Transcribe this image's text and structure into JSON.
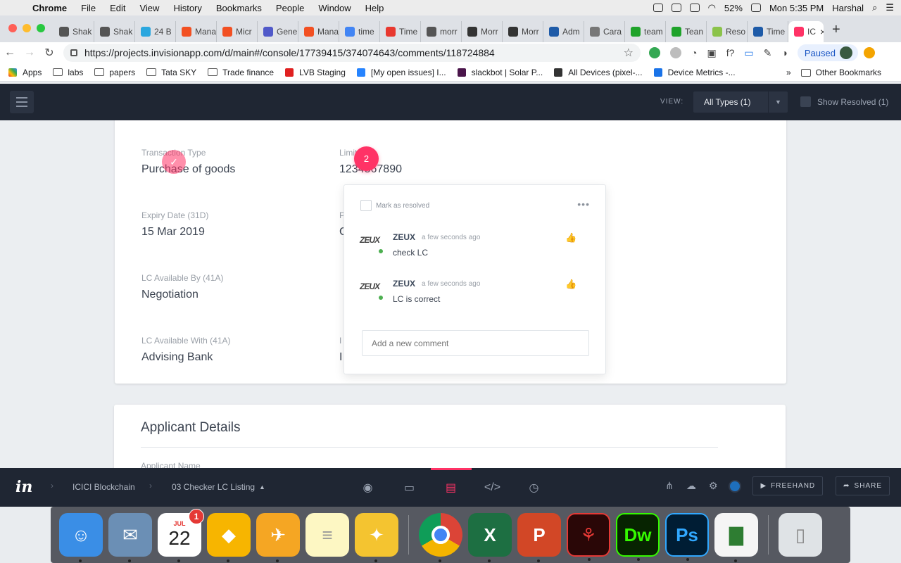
{
  "menubar": {
    "app": "Chrome",
    "items": [
      "File",
      "Edit",
      "View",
      "History",
      "Bookmarks",
      "People",
      "Window",
      "Help"
    ],
    "battery": "52%",
    "clock": "Mon 5:35 PM",
    "user": "Harshal"
  },
  "tabs": [
    {
      "label": "Shak",
      "color": "#555555"
    },
    {
      "label": "Shak",
      "color": "#555555"
    },
    {
      "label": "24 B",
      "color": "#2aa7df"
    },
    {
      "label": "Mana",
      "color": "#f25022"
    },
    {
      "label": "Micr",
      "color": "#f25022"
    },
    {
      "label": "Gene",
      "color": "#5059c9"
    },
    {
      "label": "Mana",
      "color": "#f25022"
    },
    {
      "label": "time",
      "color": "#4285f4"
    },
    {
      "label": "Time",
      "color": "#e8382f"
    },
    {
      "label": "morr",
      "color": "#555555"
    },
    {
      "label": "Morr",
      "color": "#333333"
    },
    {
      "label": "Morr",
      "color": "#333333"
    },
    {
      "label": "Adm",
      "color": "#1e5ba8"
    },
    {
      "label": "Cara",
      "color": "#777777"
    },
    {
      "label": "team",
      "color": "#1fa32a"
    },
    {
      "label": "Tean",
      "color": "#1fa32a"
    },
    {
      "label": "Reso",
      "color": "#8bc34a"
    },
    {
      "label": "Time",
      "color": "#1e5ba8"
    }
  ],
  "active_tab": {
    "label": "IC",
    "color": "#ff3366"
  },
  "url": "https://projects.invisionapp.com/d/main#/console/17739415/374074643/comments/118724884",
  "profile_status": "Paused",
  "bookmarks": [
    {
      "label": "Apps",
      "kind": "apps"
    },
    {
      "label": "labs",
      "kind": "folder"
    },
    {
      "label": "papers",
      "kind": "folder"
    },
    {
      "label": "Tata SKY",
      "kind": "folder"
    },
    {
      "label": "Trade finance",
      "kind": "folder"
    },
    {
      "label": "LVB Staging",
      "kind": "site",
      "color": "#e02020"
    },
    {
      "label": "[My open issues] I...",
      "kind": "site",
      "color": "#2684ff"
    },
    {
      "label": "slackbot | Solar P...",
      "kind": "site",
      "color": "#4a154b"
    },
    {
      "label": "All Devices (pixel-...",
      "kind": "site",
      "color": "#333333"
    },
    {
      "label": "Device Metrics -...",
      "kind": "site",
      "color": "#1a73e8"
    }
  ],
  "bookmarks_overflow": "»",
  "other_bookmarks": "Other Bookmarks",
  "header": {
    "view_label": "VIEW:",
    "view_value": "All Types (1)",
    "show_resolved": "Show Resolved (1)"
  },
  "form": {
    "transaction_type_label": "Transaction Type",
    "transaction_type_value": "Purchase of goods",
    "limit_label": "Limit",
    "limit_value": "1234567890",
    "expiry_label": "Expiry Date (31D)",
    "expiry_value": "15 Mar 2019",
    "available_by_label": "LC Available By (41A)",
    "available_by_value": "Negotiation",
    "available_with_label": "LC Available With (41A)",
    "available_with_value": "Advising Bank",
    "partial_p_label": "P",
    "partial_c_value": "C",
    "partial_i_label": "I",
    "partial_i_value": "I"
  },
  "applicant": {
    "title": "Applicant Details",
    "name_label": "Applicant Name"
  },
  "pins": {
    "resolved_mark": "✓",
    "active_number": "2"
  },
  "popup": {
    "mark_resolved": "Mark as resolved",
    "menu": "•••",
    "comments": [
      {
        "author": "ZEUX",
        "time": "a few seconds ago",
        "text": "check LC",
        "logo": "ZEUX"
      },
      {
        "author": "ZEUX",
        "time": "a few seconds ago",
        "text": "LC is correct",
        "logo": "ZEUX"
      }
    ],
    "placeholder": "Add a new comment"
  },
  "bottom": {
    "logo": "in",
    "project": "ICICI Blockchain",
    "screen": "03 Checker LC Listing",
    "freehand": "FREEHAND",
    "share": "SHARE"
  },
  "dock": {
    "calendar_month": "JUL",
    "calendar_day": "22",
    "calendar_badge": "1",
    "apps": [
      {
        "name": "Finder",
        "color": "#3a8ee6"
      },
      {
        "name": "Preview",
        "color": "#6b8fb5"
      },
      {
        "name": "Calendar",
        "color": "#ffffff"
      },
      {
        "name": "Sketch",
        "color": "#f7b500"
      },
      {
        "name": "Mail",
        "color": "#f5a623"
      },
      {
        "name": "Notes",
        "color": "#fdf7c3"
      },
      {
        "name": "Keynote",
        "color": "#f4c430"
      },
      {
        "name": "Chrome",
        "color": "#ffffff"
      },
      {
        "name": "Excel",
        "color": "#1d6f42"
      },
      {
        "name": "PowerPoint",
        "color": "#d24726"
      },
      {
        "name": "Acrobat",
        "color": "#2a0707"
      },
      {
        "name": "Dreamweaver",
        "color": "#072401"
      },
      {
        "name": "Photoshop",
        "color": "#001d34"
      },
      {
        "name": "Numbers",
        "color": "#f5f5f5"
      },
      {
        "name": "Trash",
        "color": "#dfe3e6"
      }
    ],
    "excel_letter": "X",
    "powerpoint_letter": "P",
    "dreamweaver_letter": "Dw",
    "photoshop_letter": "Ps"
  }
}
